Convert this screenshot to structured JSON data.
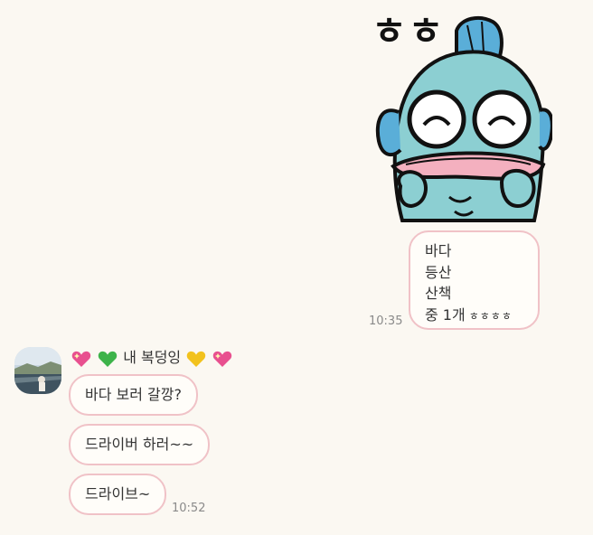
{
  "sticker": {
    "text": "ㅎㅎ",
    "icon": "hangyodon-blush-sticker"
  },
  "outgoing": {
    "lines": [
      "바다",
      "등산",
      "산책",
      "중 1개"
    ],
    "last_suffix": "ㅎㅎㅎㅎ",
    "time": "10:35"
  },
  "incoming": {
    "sender": {
      "name": "내 복덩잉",
      "emoji_left": [
        "sparkling-heart",
        "green-heart"
      ],
      "emoji_right": [
        "yellow-heart",
        "sparkling-heart"
      ]
    },
    "messages": [
      {
        "text": "바다 보러 갈깡?"
      },
      {
        "text": "드라이버 하러~~"
      },
      {
        "text": "드라이브~"
      }
    ],
    "time": "10:52"
  },
  "colors": {
    "background": "#fbf8f2",
    "bubble_border": "#f0c2c7",
    "bubble_fill": "#fffdf9",
    "sticker_blue": "#8ccfd2",
    "sticker_lip": "#f4b0bf"
  }
}
